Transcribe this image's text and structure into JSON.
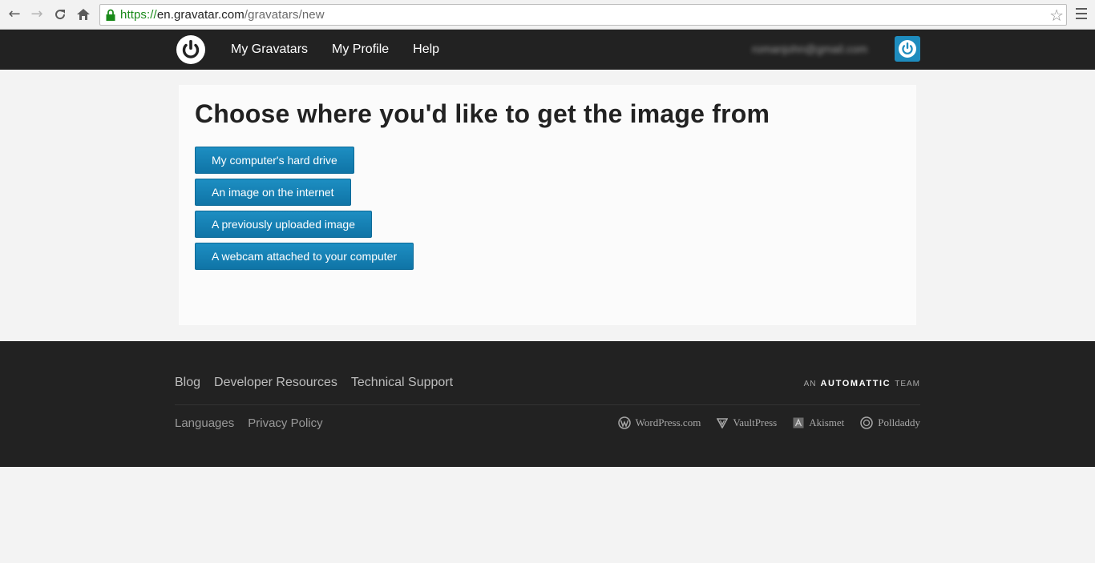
{
  "browser": {
    "url_scheme": "https://",
    "url_host": "en.gravatar.com",
    "url_path": "/gravatars/new"
  },
  "header": {
    "nav": [
      "My Gravatars",
      "My Profile",
      "Help"
    ],
    "user_email": "romanjohn@gmail.com"
  },
  "main": {
    "title": "Choose where you'd like to get the image from",
    "options": [
      "My computer's hard drive",
      "An image on the internet",
      "A previously uploaded image",
      "A webcam attached to your computer"
    ]
  },
  "footer": {
    "top_links": [
      "Blog",
      "Developer Resources",
      "Technical Support"
    ],
    "bottom_links": [
      "Languages",
      "Privacy Policy"
    ],
    "automattic_pre": "AN",
    "automattic_brand": "AUTOMATTIC",
    "automattic_post": "TEAM",
    "family": [
      "WordPress.com",
      "VaultPress",
      "Akismet",
      "Polldaddy"
    ]
  },
  "colors": {
    "accent": "#1e8cbe",
    "header_bg": "#222222"
  }
}
